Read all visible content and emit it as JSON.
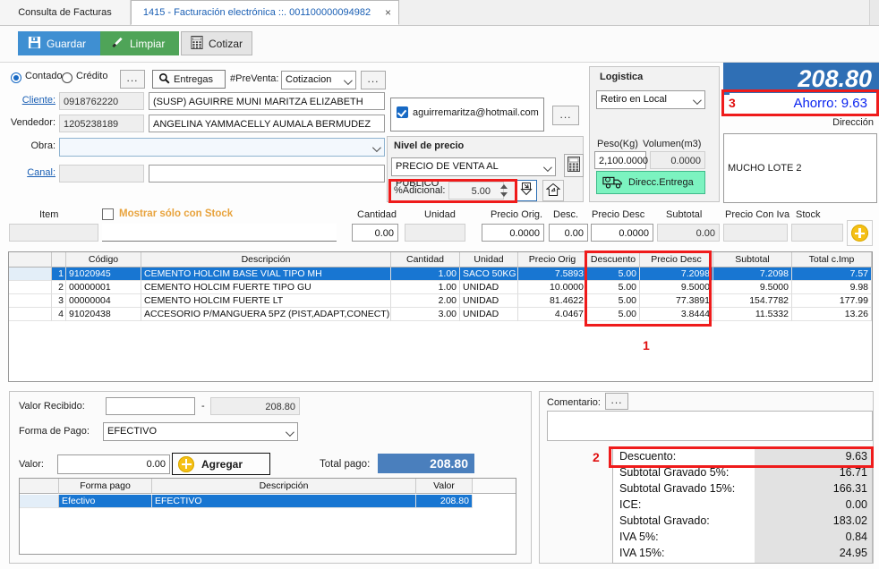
{
  "window": {
    "tabs": [
      {
        "label": "Consulta de Facturas",
        "active": false
      },
      {
        "label": "1415 - Facturación electrónica ::. 001100000094982",
        "active": true
      }
    ],
    "close_glyph": "×"
  },
  "toolbar": {
    "save_label": "Guardar",
    "clean_label": "Limpiar",
    "quote_label": "Cotizar"
  },
  "header_form": {
    "contado_label": "Contado",
    "credito_label": "Crédito",
    "dots_label": "...",
    "entregas_label": "Entregas",
    "preventa_label": "#PreVenta:",
    "preventa_value": "Cotizacion",
    "cliente_label": "Cliente:",
    "cliente_id": "0918762220",
    "cliente_name": "(SUSP) AGUIRRE MUNI MARITZA ELIZABETH",
    "vendedor_label": "Vendedor:",
    "vendedor_id": "1205238189",
    "vendedor_name": "ANGELINA YAMMACELLY AUMALA BERMUDEZ",
    "obra_label": "Obra:",
    "obra_value": "",
    "canal_label": "Canal:",
    "canal_code": "",
    "canal_value": ""
  },
  "email": {
    "value": "aguirremaritza@hotmail.com",
    "dots_label": "..."
  },
  "price_level": {
    "title": "Nivel de precio",
    "selected": "PRECIO DE VENTA AL PUBLICO",
    "adicional_label": "%Adicional:",
    "adicional_value": "5.00"
  },
  "logistica": {
    "title": "Logistica",
    "mode": "Retiro en Local",
    "peso_label": "Peso(Kg)",
    "peso_value": "2,100.0000",
    "volumen_label": "Volumen(m3)",
    "volumen_value": "0.0000",
    "direcc_button": "Direcc.Entrega"
  },
  "total_header": {
    "total": "208.80",
    "ahorro": "Ahorro: 9.63",
    "direccion_label": "Dirección",
    "direccion_value": "MUCHO LOTE 2"
  },
  "item_entry": {
    "item_label": "Item",
    "item_value": "",
    "stock_checkbox_label": "Mostrar sólo con Stock",
    "descripcion_value": "",
    "fields": [
      {
        "label": "Cantidad",
        "value": "0.00"
      },
      {
        "label": "Unidad",
        "value": ""
      },
      {
        "label": "Precio Orig.",
        "value": "0.0000"
      },
      {
        "label": "Desc.",
        "value": "0.00"
      },
      {
        "label": "Precio Desc",
        "value": "0.0000"
      },
      {
        "label": "Subtotal",
        "value": "0.00"
      },
      {
        "label": "Precio Con Iva",
        "value": ""
      },
      {
        "label": "Stock",
        "value": ""
      }
    ]
  },
  "items_grid": {
    "columns": [
      "",
      "",
      "Código",
      "Descripción",
      "Cantidad",
      "Unidad",
      "Precio Orig",
      "Descuento",
      "Precio Desc",
      "Subtotal",
      "Total c.Imp"
    ],
    "rows": [
      {
        "n": "1",
        "codigo": "91020945",
        "descripcion": "CEMENTO HOLCIM BASE VIAL TIPO MH",
        "cantidad": "1.00",
        "unidad": "SACO 50KG",
        "precio_orig": "7.5893",
        "descuento": "5.00",
        "precio_desc": "7.2098",
        "subtotal": "7.2098",
        "total_imp": "7.57",
        "selected": true
      },
      {
        "n": "2",
        "codigo": "00000001",
        "descripcion": "CEMENTO HOLCIM FUERTE TIPO GU",
        "cantidad": "1.00",
        "unidad": "UNIDAD",
        "precio_orig": "10.0000",
        "descuento": "5.00",
        "precio_desc": "9.5000",
        "subtotal": "9.5000",
        "total_imp": "9.98",
        "selected": false
      },
      {
        "n": "3",
        "codigo": "00000004",
        "descripcion": "CEMENTO HOLCIM FUERTE LT",
        "cantidad": "2.00",
        "unidad": "UNIDAD",
        "precio_orig": "81.4622",
        "descuento": "5.00",
        "precio_desc": "77.3891",
        "subtotal": "154.7782",
        "total_imp": "177.99",
        "selected": false
      },
      {
        "n": "4",
        "codigo": "91020438",
        "descripcion": "ACCESORIO P/MANGUERA 5PZ (PIST,ADAPT,CONECT)",
        "cantidad": "3.00",
        "unidad": "UNIDAD",
        "precio_orig": "4.0467",
        "descuento": "5.00",
        "precio_desc": "3.8444",
        "subtotal": "11.5332",
        "total_imp": "13.26",
        "selected": false
      }
    ]
  },
  "payment": {
    "valor_recibido_label": "Valor Recibido:",
    "valor_recibido_value": "",
    "dash": "-",
    "valor_recibido_total": "208.80",
    "forma_pago_label": "Forma de Pago:",
    "forma_pago_value": "EFECTIVO",
    "valor_label": "Valor:",
    "valor_value": "0.00",
    "agregar_label": "Agregar",
    "total_pago_label": "Total pago:",
    "total_pago_value": "208.80",
    "grid": {
      "columns": [
        "",
        "Forma pago",
        "Descripción",
        "Valor"
      ],
      "rows": [
        {
          "forma": "Efectivo",
          "descripcion": "EFECTIVO",
          "valor": "208.80",
          "selected": true
        }
      ]
    }
  },
  "comment": {
    "label": "Comentario:",
    "dots_label": "...",
    "value": ""
  },
  "totals": {
    "rows": [
      {
        "label": "Descuento:",
        "value": "9.63"
      },
      {
        "label": "Subtotal Gravado 5%:",
        "value": "16.71"
      },
      {
        "label": "Subtotal Gravado 15%:",
        "value": "166.31"
      },
      {
        "label": "ICE:",
        "value": "0.00"
      },
      {
        "label": "Subtotal Gravado:",
        "value": "183.02"
      },
      {
        "label": "IVA 5%:",
        "value": "0.84"
      },
      {
        "label": "IVA 15%:",
        "value": "24.95"
      }
    ]
  },
  "annotations": [
    {
      "id": "1",
      "label": "1"
    },
    {
      "id": "2",
      "label": "2"
    },
    {
      "id": "3",
      "label": "3"
    }
  ],
  "colors": {
    "accent_blue": "#2f6fb5",
    "save_blue": "#3f8fd2",
    "clean_green": "#4fa458",
    "annotation_red": "#ef1b1b",
    "link_blue": "#1a5fb4",
    "warn_orange": "#e8a33d",
    "row_select": "#1876d2",
    "plus_yellow": "#f5c016",
    "delivery_green": "#7cf3c0"
  }
}
